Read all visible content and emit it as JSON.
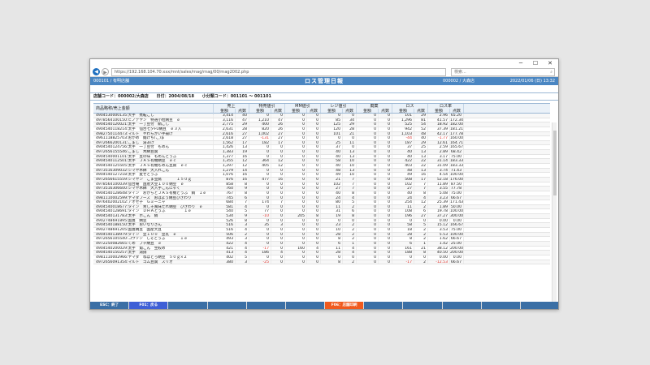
{
  "browser": {
    "url": "https://192.168.104.70:xxx/mnt/sales/rnag/rnag/00/rnag2002.php",
    "search_placeholder": "検索...",
    "minimize": "─",
    "maximize": "☐",
    "close": "✕"
  },
  "app": {
    "left": "000101 / 有明店舗",
    "title": "ロス管理日報",
    "right1": "000002 / 大森店",
    "right2": "2022/01/06 (日) 13:32"
  },
  "conditions": {
    "store": "店舗コード：000002/大森店",
    "date": "日付：2004/08/18",
    "category": "小分類コード：001101 ～ 001101"
  },
  "table": {
    "group_headers": [
      "売上",
      "特売値引",
      "MM値引",
      "レジ値引",
      "廃棄",
      "ロス",
      "ロス率"
    ],
    "name_header": "商品略称/売上金額",
    "sub_amount": "金額",
    "sub_count": "点数",
    "rows": [
      [
        "4904530000135:大手　煮転ごし",
        "3,414",
        "40",
        "0",
        "0",
        "0",
        "0",
        "0",
        "0",
        "0",
        "0",
        "101",
        "29",
        "2.96",
        "65.20"
      ],
      [
        "4978564100150:ヒノデヤン　特選小粒納豆　ｅ",
        "3,116",
        "47",
        "1,210",
        "47",
        "0",
        "0",
        "85",
        "34",
        "0",
        "0",
        "1,296",
        "81",
        "41.57",
        "172.34"
      ],
      [
        "4904540120021:太手　一丁豆付　絹ごし",
        "2,775",
        "29",
        "400",
        "26",
        "0",
        "0",
        "125",
        "29",
        "0",
        "0",
        "525",
        "54",
        "18.92",
        "182.00"
      ],
      [
        "4904540118214:太手　仙台七夕FU納豆　ｅ３入",
        "2,631",
        "28",
        "820",
        "26",
        "0",
        "0",
        "120",
        "28",
        "0",
        "0",
        "942",
        "52",
        "37.39",
        "181.21"
      ],
      [
        "4982750114473:マルト　やわらかい手揚げ",
        "2,616",
        "27",
        "1,002",
        "27",
        "0",
        "0",
        "101",
        "21",
        "0",
        "0",
        "1,103",
        "48",
        "42.17",
        "177.78"
      ],
      [
        "4961118825703:おかめ　麺けち(こ)ま",
        "2,618",
        "27",
        "-131",
        "27",
        "0",
        "0",
        "0",
        "0",
        "0",
        "0",
        "-44",
        "40",
        "-1.77",
        "160.00"
      ],
      [
        "4972666200131:こまし　湯あげ",
        "1,562",
        "17",
        "182",
        "17",
        "0",
        "0",
        "25",
        "11",
        "0",
        "0",
        "187",
        "29",
        "12.61",
        "164.71"
      ],
      [
        "4904540124756:太手　一丁豆付　もめん",
        "1,426",
        "13",
        "0",
        "0",
        "0",
        "0",
        "37",
        "0",
        "0",
        "0",
        "37",
        "25",
        "2.59",
        "165.67"
      ],
      [
        "4972656155546:こまし　木綿豆腐",
        "1,383",
        "19",
        "0",
        "0",
        "0",
        "0",
        "40",
        "13",
        "0",
        "0",
        "40",
        "13",
        "2.89",
        "68.42"
      ],
      [
        "4904540001101:太手　豆の味　もめんとうふ",
        "1,377",
        "16",
        "0",
        "0",
        "0",
        "0",
        "40",
        "13",
        "0",
        "0",
        "40",
        "13",
        "3.17",
        "75.00"
      ],
      [
        "4904540112501:太手　ＪＡＳ有機納豆　ｅｃ",
        "1,355",
        "12",
        "364",
        "12",
        "0",
        "0",
        "58",
        "10",
        "0",
        "0",
        "422",
        "22",
        "31.14",
        "183.33"
      ],
      [
        "4904540125505:太手　ＪＡＳ有機もめん豆腐　ｅｃ",
        "1,297",
        "12",
        "405",
        "12",
        "0",
        "0",
        "40",
        "10",
        "0",
        "0",
        "403",
        "22",
        "31.09",
        "183.33"
      ],
      [
        "4973516309032:シマヤ木綿　大入れこん",
        "1,279",
        "14",
        "0",
        "0",
        "0",
        "0",
        "48",
        "13",
        "0",
        "0",
        "48",
        "13",
        "3.74",
        "71.43"
      ],
      [
        "4904540127218:太手　麦せとうふ",
        "1,076",
        "16",
        "0",
        "0",
        "0",
        "0",
        "49",
        "10",
        "0",
        "0",
        "49",
        "16",
        "4.54",
        "100.00"
      ],
      [
        "4972656615559:シマヤン　ごま豆腐　　　　１５０ｇ",
        "876",
        "16",
        "477",
        "16",
        "0",
        "0",
        "21",
        "7",
        "0",
        "0",
        "508",
        "17",
        "52.18",
        "176.00"
      ],
      [
        "4978564100039:仙台庵　国産大豆１００納豆　ｅ",
        "858",
        "8",
        "0",
        "0",
        "0",
        "0",
        "102",
        "7",
        "0",
        "0",
        "102",
        "7",
        "11.89",
        "87.50"
      ],
      [
        "4973516306600:シマヤ木綿　大入手こんにゃく",
        "760",
        "9",
        "0",
        "0",
        "0",
        "0",
        "27",
        "7",
        "0",
        "0",
        "27",
        "7",
        "3.55",
        "77.78"
      ],
      [
        "4904540128648:タイン　おからとＪＡＳ有機とうふ　絹　１ｅ",
        "767",
        "8",
        "0",
        "0",
        "0",
        "0",
        "40",
        "8",
        "0",
        "0",
        "40",
        "8",
        "5.08",
        "75.00"
      ],
      [
        "4981110002599:ヤマダフーズ　おはよう納豆ひきわり",
        "745",
        "6",
        "0",
        "0",
        "0",
        "0",
        "24",
        "4",
        "0",
        "0",
        "24",
        "4",
        "3.23",
        "66.67"
      ],
      [
        "4976402002102:アオセ子　Ｇミーニャ",
        "684",
        "7",
        "174",
        "7",
        "0",
        "0",
        "80",
        "5",
        "0",
        "0",
        "254",
        "12",
        "25.39",
        "171.43"
      ],
      [
        "4904540018677:タイン　青しそ風味たれ納豆　ひきわり　ｅ",
        "581",
        "4",
        "0",
        "0",
        "0",
        "0",
        "11",
        "2",
        "0",
        "0",
        "11",
        "2",
        "1.89",
        "50.00"
      ],
      [
        "4904540128691:タイン　ＤＨＡとうふ　　　　　１ｅ",
        "540",
        "5",
        "77",
        "0",
        "0",
        "0",
        "31",
        "6",
        "0",
        "0",
        "108",
        "6",
        "19.78",
        "100.00"
      ],
      [
        "4904540131783:太手　ホこん　絹",
        "534",
        "9",
        "-10",
        "0",
        "205",
        "8",
        "19",
        "8",
        "0",
        "0",
        "196",
        "27",
        "37.27",
        "300.00"
      ],
      [
        "4902748691895:国豊　納豆",
        "526",
        "8",
        "0",
        "0",
        "0",
        "0",
        "0",
        "0",
        "0",
        "0",
        "0",
        "0",
        "0.00",
        "0.00"
      ],
      [
        "4904540188150:太手　おいなりさん",
        "516",
        "3",
        "35",
        "3",
        "0",
        "0",
        "23",
        "2",
        "0",
        "0",
        "58",
        "5",
        "15.12",
        "166.67"
      ],
      [
        "4902748691205:国豊納豆　国産大豆",
        "516",
        "4",
        "0",
        "0",
        "0",
        "0",
        "10",
        "2",
        "0",
        "0",
        "18",
        "2",
        "3.53",
        "75.00"
      ],
      [
        "4904540138979:タイン　豆１００　豆乳　ｅ",
        "506",
        "2",
        "0",
        "0",
        "0",
        "0",
        "28",
        "2",
        "0",
        "0",
        "28",
        "2",
        "5.53",
        "100.00"
      ],
      [
        "4972656105540:コウソン　しそとうふ　　　　１ｅ",
        "493",
        "3",
        "0",
        "0",
        "0",
        "0",
        "8",
        "2",
        "0",
        "0",
        "8",
        "2",
        "1.62",
        "66.67"
      ],
      [
        "4972250082665:くめ　ブチ納豆　ｅ",
        "422",
        "4",
        "0",
        "0",
        "0",
        "0",
        "6",
        "1",
        "0",
        "0",
        "6",
        "1",
        "1.42",
        "25.00"
      ],
      [
        "4904540200029:太手　角こん　生絞め",
        "421",
        "4",
        "-17",
        "0",
        "160",
        "4",
        "11",
        "4",
        "0",
        "0",
        "161",
        "21",
        "38.12",
        "200.00"
      ],
      [
        "4904540150257:太手　湯揚",
        "413",
        "4",
        "186",
        "4",
        "0",
        "0",
        "28",
        "4",
        "0",
        "0",
        "188",
        "8",
        "40.50",
        "200.00"
      ],
      [
        "4981110002966:ヤマダ　ねばとろ納豆　５０ｇ×２",
        "402",
        "5",
        "0",
        "0",
        "0",
        "0",
        "0",
        "0",
        "0",
        "0",
        "0",
        "0",
        "0.00",
        "0.00"
      ],
      [
        "4972656091354:マルト　ゴム豆腐　スリオ",
        "380",
        "3",
        "-25",
        "0",
        "0",
        "0",
        "8",
        "2",
        "0",
        "0",
        "-17",
        "2",
        "-12.53",
        "66.67"
      ]
    ]
  },
  "footer": {
    "keys": [
      "ESC：終了",
      "F01：戻る",
      "",
      "",
      "",
      "",
      "F06：店舗印刷",
      "",
      "",
      "",
      "",
      ""
    ]
  }
}
